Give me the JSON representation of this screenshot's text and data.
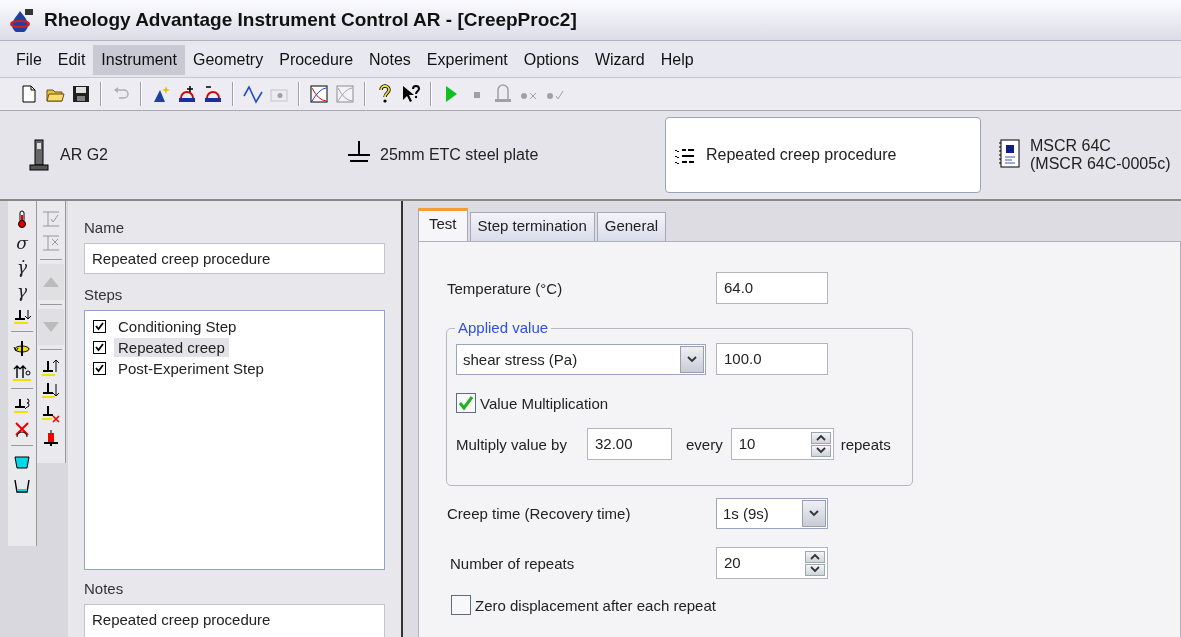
{
  "window": {
    "title": "Rheology Advantage Instrument Control AR - [CreepProc2]"
  },
  "menu": [
    {
      "label": "File",
      "selected": false
    },
    {
      "label": "Edit",
      "selected": false
    },
    {
      "label": "Instrument",
      "selected": true
    },
    {
      "label": "Geometry",
      "selected": false
    },
    {
      "label": "Procedure",
      "selected": false
    },
    {
      "label": "Notes",
      "selected": false
    },
    {
      "label": "Experiment",
      "selected": false
    },
    {
      "label": "Options",
      "selected": false
    },
    {
      "label": "Wizard",
      "selected": false
    },
    {
      "label": "Help",
      "selected": false
    }
  ],
  "toolbar": [
    {
      "kind": "new",
      "disabled": false
    },
    {
      "kind": "open",
      "disabled": false
    },
    {
      "kind": "save",
      "disabled": false
    },
    {
      "kind": "separator"
    },
    {
      "kind": "undo",
      "disabled": true
    },
    {
      "kind": "separator"
    },
    {
      "kind": "wand",
      "disabled": false
    },
    {
      "kind": "step-add",
      "disabled": false
    },
    {
      "kind": "step-remove",
      "disabled": false
    },
    {
      "kind": "separator"
    },
    {
      "kind": "wave",
      "disabled": false
    },
    {
      "kind": "camera",
      "disabled": true
    },
    {
      "kind": "separator"
    },
    {
      "kind": "chart",
      "disabled": false
    },
    {
      "kind": "chart",
      "disabled": true
    },
    {
      "kind": "separator"
    },
    {
      "kind": "help",
      "disabled": false
    },
    {
      "kind": "context-help",
      "disabled": false
    },
    {
      "kind": "separator"
    },
    {
      "kind": "play",
      "disabled": false
    },
    {
      "kind": "stop",
      "disabled": true
    },
    {
      "kind": "lift",
      "disabled": true
    },
    {
      "kind": "dot-x",
      "disabled": true
    },
    {
      "kind": "dot-check",
      "disabled": true
    }
  ],
  "header": [
    {
      "kind": "instrument",
      "lines": [
        "AR G2"
      ],
      "selected": false
    },
    {
      "kind": "geometry",
      "lines": [
        "25mm ETC steel plate"
      ],
      "selected": false
    },
    {
      "kind": "procedure",
      "lines": [
        "Repeated creep procedure"
      ],
      "selected": true
    },
    {
      "kind": "notes",
      "lines": [
        "MSCR 64C",
        "(MSCR 64C-0005c)"
      ],
      "selected": false
    }
  ],
  "tool_strip_1": [
    {
      "kind": "thermometer"
    },
    {
      "kind": "glyph",
      "text": "σ"
    },
    {
      "kind": "glyph",
      "text": "γ̇"
    },
    {
      "kind": "glyph",
      "text": "γ"
    },
    {
      "kind": "plate-return"
    },
    {
      "kind": "separator"
    },
    {
      "kind": "rotate"
    },
    {
      "kind": "arrows"
    },
    {
      "kind": "separator"
    },
    {
      "kind": "plate-loop"
    },
    {
      "kind": "cross"
    },
    {
      "kind": "separator"
    },
    {
      "kind": "cup-filled"
    },
    {
      "kind": "cup-empty"
    }
  ],
  "tool_strip_2": [
    {
      "kind": "step-check",
      "disabled": true
    },
    {
      "kind": "step-cross",
      "disabled": true
    },
    {
      "kind": "separator"
    },
    {
      "kind": "move-up",
      "disabled": true
    },
    {
      "kind": "separator"
    },
    {
      "kind": "move-down",
      "disabled": true
    },
    {
      "kind": "separator"
    },
    {
      "kind": "plate-up",
      "disabled": false
    },
    {
      "kind": "plate-down",
      "disabled": false
    },
    {
      "kind": "plate-x",
      "disabled": false
    },
    {
      "kind": "weight",
      "disabled": false
    }
  ],
  "procedure": {
    "name_label": "Name",
    "name": "Repeated creep procedure",
    "steps_label": "Steps",
    "steps": [
      {
        "label": "Conditioning Step",
        "checked": true,
        "selected": false
      },
      {
        "label": "Repeated creep",
        "checked": true,
        "selected": true
      },
      {
        "label": "Post-Experiment Step",
        "checked": true,
        "selected": false
      }
    ],
    "notes_label": "Notes",
    "notes": "Repeated creep procedure"
  },
  "test": {
    "tabs": [
      {
        "label": "Test",
        "selected": true
      },
      {
        "label": "Step termination",
        "selected": false
      },
      {
        "label": "General",
        "selected": false
      }
    ],
    "temperature": {
      "label": "Temperature (°C)",
      "value": "64.0"
    },
    "applied_value": {
      "legend": "Applied value",
      "mode": "shear stress (Pa)",
      "value": "100.0",
      "multiplication": {
        "label": "Value Multiplication",
        "checked": true
      },
      "multiply_label": "Multiply value by",
      "multiply_value": "32.00",
      "every_label": "every",
      "every_value": "10",
      "repeats_label": "repeats"
    },
    "creep_time": {
      "label": "Creep time (Recovery time)",
      "value": "1s (9s)"
    },
    "repeats": {
      "label": "Number of repeats",
      "value": "20"
    },
    "zero_displacement": {
      "label": "Zero displacement after each repeat",
      "checked": false
    }
  }
}
